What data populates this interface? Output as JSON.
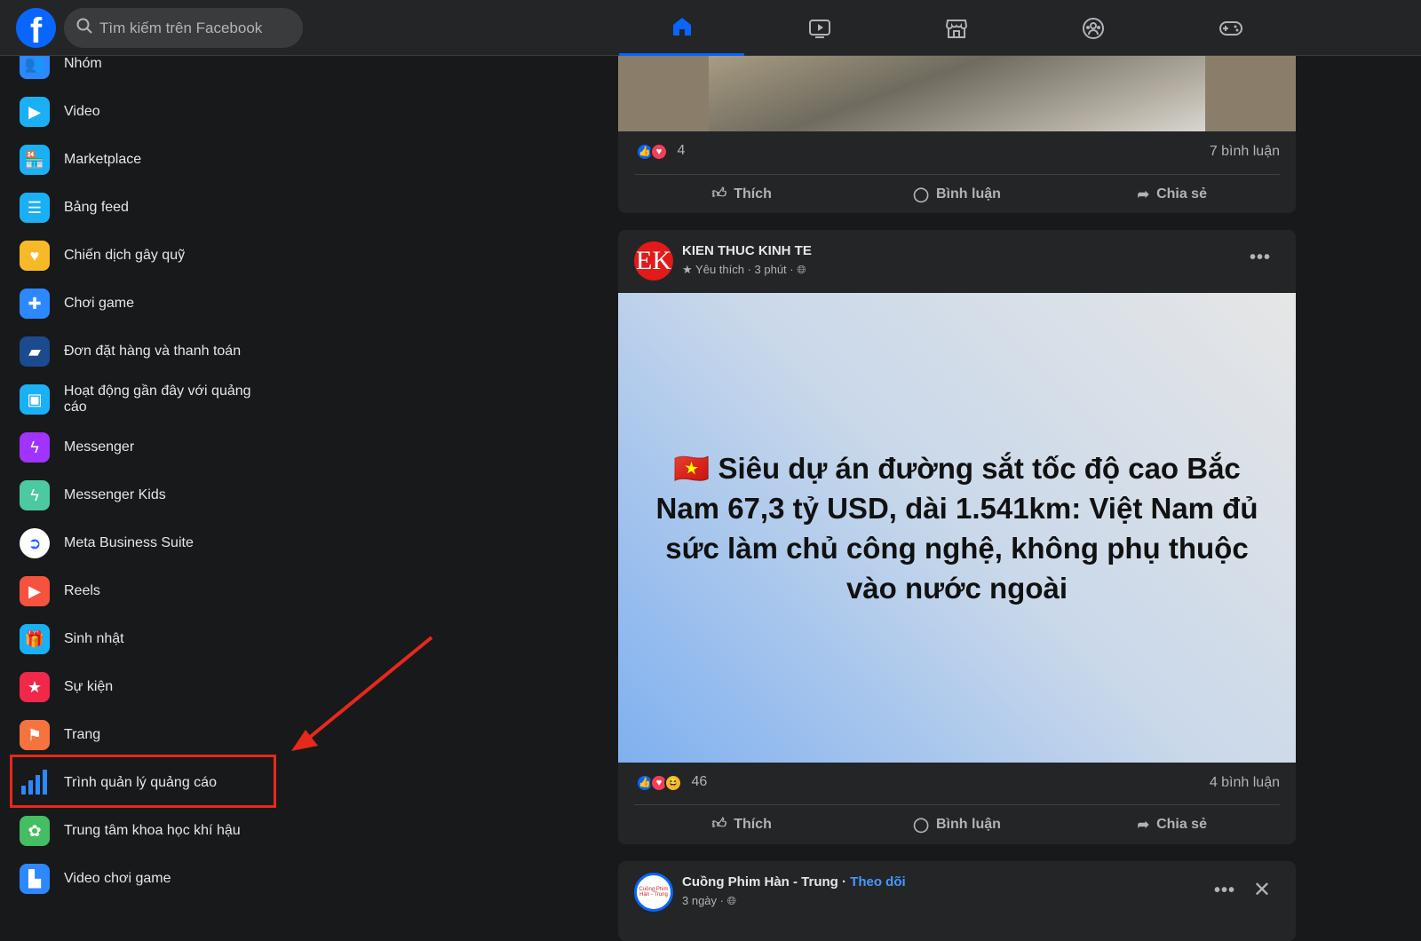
{
  "header": {
    "search_placeholder": "Tìm kiếm trên Facebook",
    "nav": [
      "home-icon",
      "video-icon",
      "marketplace-icon",
      "groups-icon",
      "gaming-icon"
    ],
    "active_nav": "home"
  },
  "sidebar": {
    "items": [
      {
        "label": "Nhóm",
        "icon": "groups-icon",
        "color": "#2d88ff"
      },
      {
        "label": "Video",
        "icon": "video-icon",
        "color": "#1ab0f5"
      },
      {
        "label": "Marketplace",
        "icon": "marketplace-icon",
        "color": "#1ab0f5"
      },
      {
        "label": "Bảng feed",
        "icon": "feeds-icon",
        "color": "#1ab0f5"
      },
      {
        "label": "Chiến dịch gây quỹ",
        "icon": "fundraiser-heart-icon",
        "color": "#f7b928"
      },
      {
        "label": "Chơi game",
        "icon": "gamepad-icon",
        "color": "#2d88ff"
      },
      {
        "label": "Đơn đặt hàng và thanh toán",
        "icon": "payment-card-icon",
        "color": "#1c4a8f"
      },
      {
        "label": "Hoạt động gần đây với quảng cáo",
        "icon": "ad-activity-icon",
        "color": "#1ab0f5"
      },
      {
        "label": "Messenger",
        "icon": "messenger-icon",
        "color": "#a033ff"
      },
      {
        "label": "Messenger Kids",
        "icon": "messenger-kids-icon",
        "color": "#4cc9a0"
      },
      {
        "label": "Meta Business Suite",
        "icon": "business-suite-icon",
        "color": "#ffffff"
      },
      {
        "label": "Reels",
        "icon": "reels-icon",
        "color": "#f5533d"
      },
      {
        "label": "Sinh nhật",
        "icon": "gift-icon",
        "color": "#1ab0f5"
      },
      {
        "label": "Sự kiện",
        "icon": "calendar-star-icon",
        "color": "#f02849"
      },
      {
        "label": "Trang",
        "icon": "flag-icon",
        "color": "#f5733d"
      },
      {
        "label": "Trình quản lý quảng cáo",
        "icon": "ads-manager-chart-icon",
        "color": "#2d88ff"
      },
      {
        "label": "Trung tâm khoa học khí hậu",
        "icon": "climate-plant-icon",
        "color": "#45bd62"
      },
      {
        "label": "Video chơi game",
        "icon": "gaming-video-icon",
        "color": "#2d88ff"
      }
    ],
    "highlighted": "Trình quản lý quảng cáo",
    "annotation_color": "#e8281c"
  },
  "posts": [
    {
      "reactions": "4",
      "comments": "7 bình luận",
      "actions": [
        "Thích",
        "Bình luận",
        "Chia sẻ"
      ]
    },
    {
      "author": "KIEN THUC KINH TE",
      "avatar_text": "EK",
      "meta": "Yêu thích · 3 phút ·",
      "image_text": "🇻🇳 Siêu dự án đường sắt tốc độ cao Bắc Nam 67,3 tỷ USD, dài 1.541km: Việt Nam đủ sức làm chủ công nghệ, không phụ thuộc vào nước ngoài",
      "reactions": "46",
      "comments": "4 bình luận",
      "actions": [
        "Thích",
        "Bình luận",
        "Chia sẻ"
      ]
    },
    {
      "author": "Cuồng Phim Hàn - Trung",
      "follow": "Theo dõi",
      "meta": "3 ngày ·",
      "avatar_text": "Cuồng Phim Hàn - Trung"
    }
  ],
  "colors": {
    "accent": "#0866ff",
    "link": "#4599ff"
  }
}
